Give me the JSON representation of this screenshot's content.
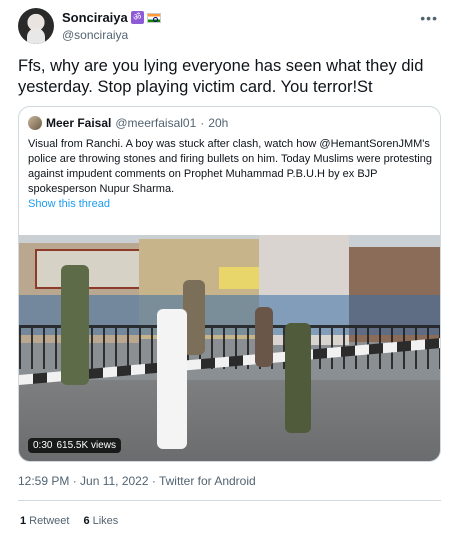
{
  "user": {
    "display_name": "Sonciraiya",
    "badge_glyph": "ॐ",
    "handle": "@sonciraiya"
  },
  "tweet": {
    "text": "Ffs, why are you lying everyone has seen what they did yesterday. Stop playing victim card. You terror!St"
  },
  "quoted": {
    "name": "Meer Faisal",
    "handle": "@meerfaisal01",
    "separator": "·",
    "time": "20h",
    "text": "Visual from Ranchi. A boy was stuck after clash, watch how @HemantSorenJMM's police are throwing stones and firing bullets on him. Today Muslims  were protesting against impudent comments on Prophet Muhammad P.B.U.H by ex BJP spokesperson Nupur Sharma.",
    "show_thread": "Show this thread",
    "video": {
      "duration": "0:30",
      "views": "615.5K views"
    }
  },
  "meta": {
    "timestamp": "12:59 PM · Jun 11, 2022 · Twitter for Android"
  },
  "stats": {
    "retweets_count": "1",
    "retweets_label": "Retweet",
    "likes_count": "6",
    "likes_label": "Likes"
  },
  "icons": {
    "more": "more-horizontal-icon",
    "om": "om-symbol-icon",
    "flag": "india-flag-icon"
  },
  "colors": {
    "link": "#1d9bf0",
    "secondary_text": "#536471",
    "border": "#cfd9de"
  }
}
